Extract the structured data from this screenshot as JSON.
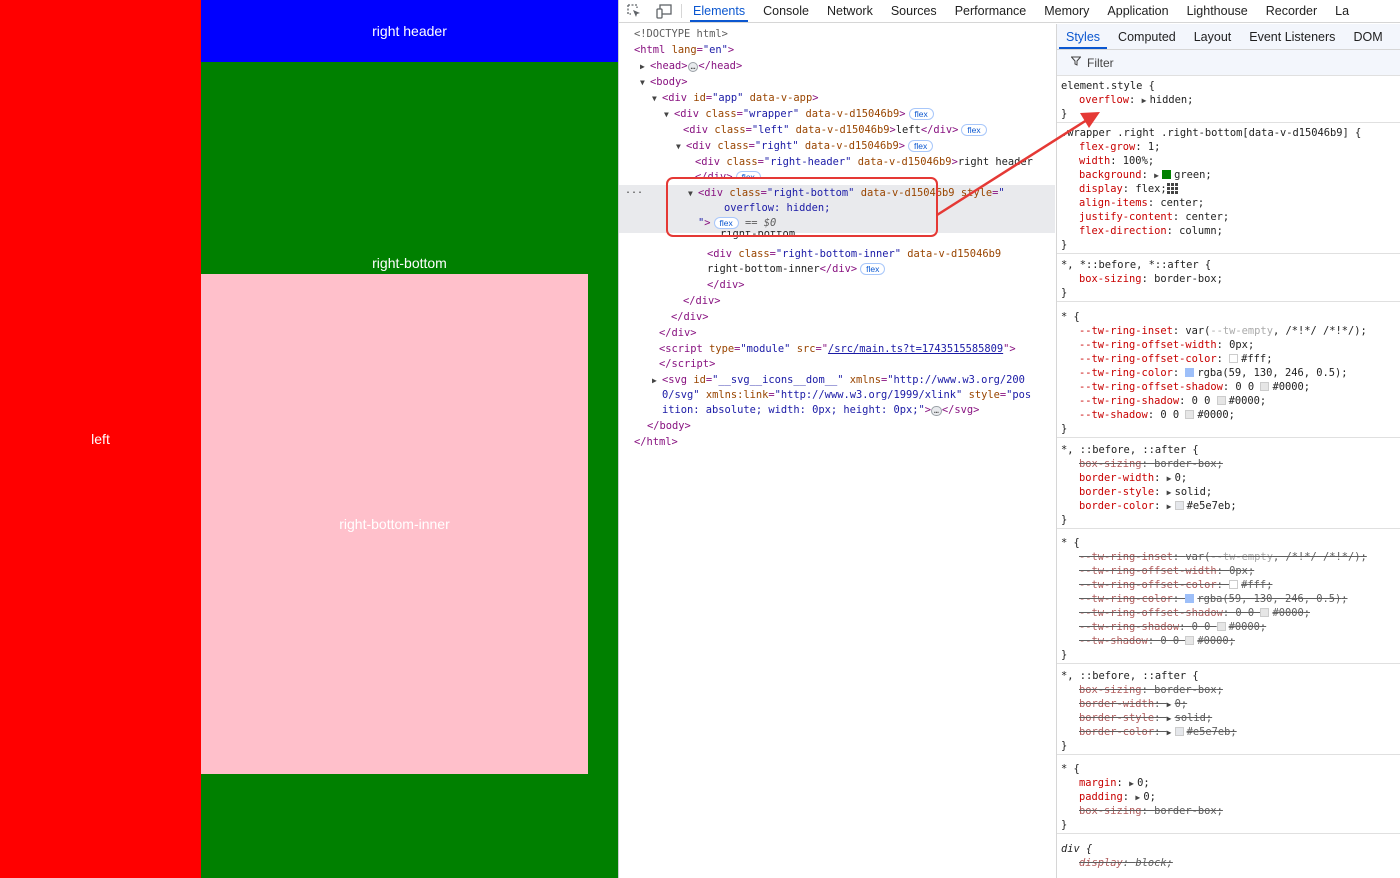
{
  "preview": {
    "left_label": "left",
    "right_header_label": "right header",
    "right_bottom_label": "right-bottom",
    "right_bottom_inner_label": "right-bottom-inner",
    "colors": {
      "left": "#ff0000",
      "right_header": "#0000ff",
      "right_bottom": "#008000",
      "inner": "#ffc0cb"
    }
  },
  "devtools": {
    "tabs": [
      "Elements",
      "Console",
      "Network",
      "Sources",
      "Performance",
      "Memory",
      "Application",
      "Lighthouse",
      "Recorder",
      "La"
    ],
    "active_tab": "Elements",
    "dom": {
      "doctype": "<!DOCTYPE html>",
      "html_open": "html",
      "lang_attr": "lang",
      "lang_val": "\"en\"",
      "head": "head",
      "body": "body",
      "div": "div",
      "id_attr": "id",
      "app_val": "\"app\"",
      "data_v_app": "data-v-app",
      "class_attr": "class",
      "wrapper_val": "\"wrapper\"",
      "scope_attr": "data-v-d15046b9",
      "left_val": "\"left\"",
      "left_text": "left",
      "right_val": "\"right\"",
      "right_header_val": "\"right-header\"",
      "right_header_text": "right header",
      "right_bottom_val": "\"right-bottom\"",
      "style_attr": "style",
      "style_open": "\"",
      "style_inline": "overflow: hidden;",
      "style_close": "\"",
      "eq_sel": "== $0",
      "right_bottom_text": "right-bottom",
      "right_bottom_inner_val": "\"right-bottom-inner\"",
      "right_bottom_inner_text": "right-bottom-inner",
      "script": "script",
      "type_attr": "type",
      "type_val": "\"module\"",
      "src_attr": "src",
      "src_val": "/src/main.ts?t=1743515585809",
      "svg": "svg",
      "svg_id_val": "\"__svg__icons__dom__\"",
      "xmlns_attr": "xmlns",
      "xmlns_val_a": "\"http://www.w3.org/200",
      "xmlns_val_b": "0/svg\"",
      "xlink_attr": "xmlns:link",
      "xlink_val": "\"http://www.w3.org/1999/xlink\"",
      "svg_style_val_a": "\"pos",
      "svg_style_val_b": "ition: absolute; width: 0px; height: 0px;\"",
      "flex_badge": "flex",
      "ellipsis": "…",
      "more_dots": "..."
    },
    "styles_tabs": [
      "Styles",
      "Computed",
      "Layout",
      "Event Listeners",
      "DOM"
    ],
    "active_styles_tab": "Styles",
    "filter_placeholder": "Filter",
    "rules": {
      "element_style_selector": "element.style {",
      "overflow_prop": "overflow",
      "overflow_val": "hidden",
      "close": "}",
      "rb_selector": ".wrapper .right .right-bottom[data-v-d15046b9] {",
      "rb_props": [
        {
          "p": "flex-grow",
          "v": "1"
        },
        {
          "p": "width",
          "v": "100%"
        },
        {
          "p": "background",
          "v": "green"
        },
        {
          "p": "display",
          "v": "flex"
        },
        {
          "p": "align-items",
          "v": "center"
        },
        {
          "p": "justify-content",
          "v": "center"
        },
        {
          "p": "flex-direction",
          "v": "column"
        }
      ],
      "bs_selector": "*, *::before, *::after {",
      "bs_prop": "box-sizing",
      "bs_val": "border-box",
      "star_selector": "* {",
      "tw": [
        {
          "p": "--tw-ring-inset",
          "v1": "var(",
          "v2": "--tw-empty",
          "v3": ", /*!*/ /*!*/)"
        },
        {
          "p": "--tw-ring-offset-width",
          "v": "0px"
        },
        {
          "p": "--tw-ring-offset-color",
          "v": "#fff",
          "swatch": "#ffffff"
        },
        {
          "p": "--tw-ring-color",
          "v": "rgba(59, 130, 246, 0.5)",
          "swatch": "#9dbff9"
        },
        {
          "p": "--tw-ring-offset-shadow",
          "v": "0 0 ",
          "v2": "#0000",
          "swatch": "#e6e6e6"
        },
        {
          "p": "--tw-ring-shadow",
          "v": "0 0 ",
          "v2": "#0000",
          "swatch": "#e6e6e6"
        },
        {
          "p": "--tw-shadow",
          "v": "0 0 ",
          "v2": "#0000",
          "swatch": "#e6e6e6"
        }
      ],
      "b_selector": "*, ::before, ::after {",
      "b_props": [
        {
          "p": "box-sizing",
          "v": "border-box"
        },
        {
          "p": "border-width",
          "v": "0"
        },
        {
          "p": "border-style",
          "v": "solid"
        },
        {
          "p": "border-color",
          "v": "#e5e7eb",
          "swatch": "#e5e7eb"
        }
      ],
      "m_props": [
        {
          "p": "margin",
          "v": "0"
        },
        {
          "p": "padding",
          "v": "0"
        },
        {
          "p": "box-sizing",
          "v": "border-box"
        }
      ],
      "div_selector": "div {",
      "div_display_prop": "display",
      "div_display_val": "block"
    }
  }
}
